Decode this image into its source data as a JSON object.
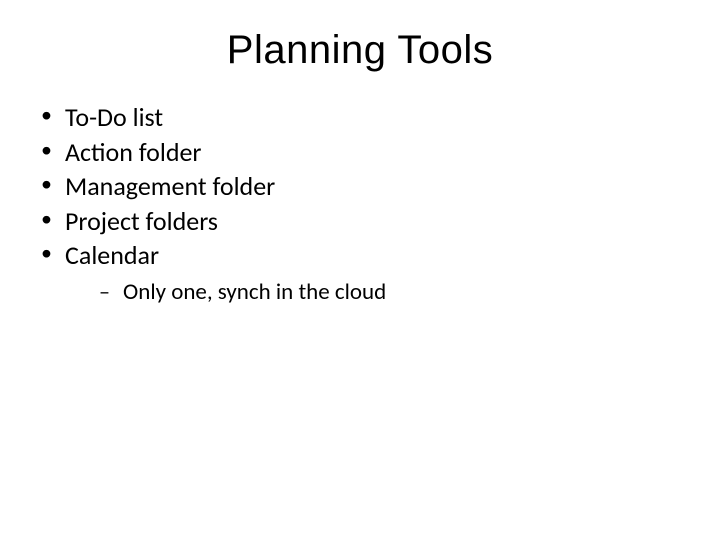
{
  "title": "Planning Tools",
  "bullets": {
    "b0": "To-Do list",
    "b1": "Action folder",
    "b2": "Management folder",
    "b3": "Project folders",
    "b4": "Calendar",
    "b4_sub0": "Only one, synch in the cloud"
  }
}
